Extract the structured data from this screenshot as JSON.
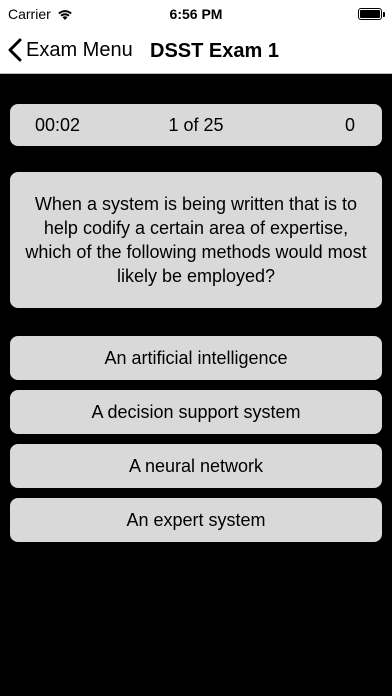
{
  "status_bar": {
    "carrier": "Carrier",
    "time": "6:56 PM"
  },
  "nav": {
    "back_label": "Exam Menu",
    "title": "DSST Exam 1"
  },
  "quiz": {
    "timer": "00:02",
    "progress": "1 of 25",
    "score": "0",
    "question": "When a system is being written that is to help codify a certain area of expertise, which of the following methods would most likely be employed?",
    "answers": [
      "An artificial intelligence",
      "A decision support system",
      "A neural network",
      "An expert system"
    ]
  },
  "colors": {
    "background": "#000000",
    "card": "#d9d9d9",
    "nav_background": "#ffffff"
  },
  "icons": {
    "back": "chevron-left-icon",
    "wifi": "wifi-icon",
    "battery": "battery-icon"
  }
}
